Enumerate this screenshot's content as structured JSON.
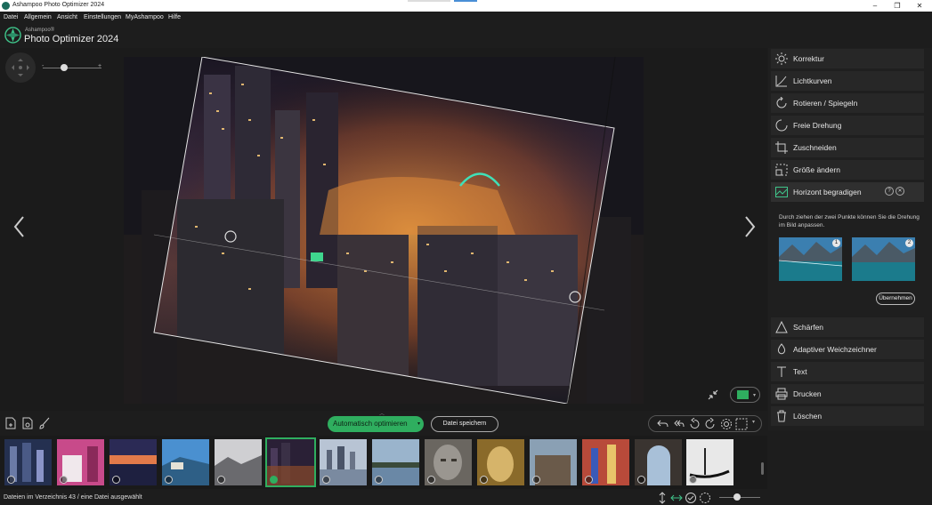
{
  "window": {
    "title": "Ashampoo Photo Optimizer 2024",
    "minimize": "–",
    "maximize": "❐",
    "close": "✕"
  },
  "menu": [
    "Datei",
    "Allgemein",
    "Ansicht",
    "Einstellungen",
    "MyAshampoo",
    "Hilfe"
  ],
  "brand": {
    "small": "Ashampoo®",
    "big": "Photo Optimizer 2024"
  },
  "zoom": {
    "minus": "-",
    "plus": "+"
  },
  "sidebar": [
    {
      "label": "Korrektur",
      "icon": "sun-icon"
    },
    {
      "label": "Lichtkurven",
      "icon": "curve-icon"
    },
    {
      "label": "Rotieren / Spiegeln",
      "icon": "rotate-icon"
    },
    {
      "label": "Freie Drehung",
      "icon": "free-rotate-icon"
    },
    {
      "label": "Zuschneiden",
      "icon": "crop-icon"
    },
    {
      "label": "Größe ändern",
      "icon": "resize-icon"
    },
    {
      "label": "Horizont begradigen",
      "icon": "horizon-icon"
    },
    {
      "label": "Schärfen",
      "icon": "sharpen-icon"
    },
    {
      "label": "Adaptiver Weichzeichner",
      "icon": "blur-drop-icon"
    },
    {
      "label": "Text",
      "icon": "text-icon"
    },
    {
      "label": "Drucken",
      "icon": "printer-icon"
    },
    {
      "label": "Löschen",
      "icon": "trash-icon"
    }
  ],
  "horizon": {
    "description": "Durch ziehen der zwei Punkte können Sie die Drehung im Bild anpassen.",
    "badge1": "1",
    "badge2": "2",
    "apply": "Übernehmen",
    "help": "?",
    "close": "✕"
  },
  "actions": {
    "auto_optimize": "Automatisch optimieren",
    "save": "Datei speichern"
  },
  "status": {
    "text": "Dateien im Verzeichnis 43 / eine Datei ausgewählt"
  },
  "colors": {
    "accent": "#2fae5f",
    "sidebar_bg": "#272727",
    "background": "#1d1d1d"
  }
}
